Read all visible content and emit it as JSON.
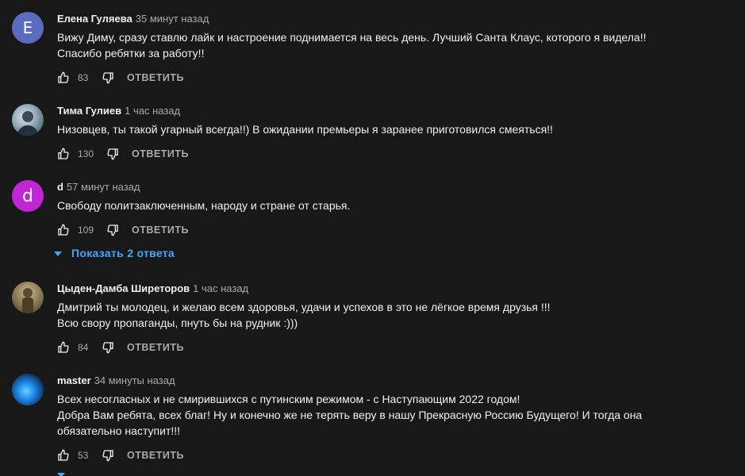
{
  "comments": [
    {
      "author": "Елена Гуляева",
      "time": "35 минут назад",
      "avatar_letter": "E",
      "avatar_color": "#5c6bc0",
      "lines": [
        "Вижу Диму, сразу ставлю лайк и настроение поднимается на весь день. Лучший Санта Клаус, которого я видела!!",
        "Спасибо ребятки за работу!!"
      ],
      "likes": "83",
      "reply_label": "ОТВЕТИТЬ"
    },
    {
      "author": "Тима Гулиев",
      "time": "1 час назад",
      "avatar_letter": "",
      "avatar_color": "#8fa9b8",
      "lines": [
        "Низовцев, ты такой угарный всегда!!) В ожидании премьеры я заранее приготовился смеяться!!"
      ],
      "likes": "130",
      "reply_label": "ОТВЕТИТЬ"
    },
    {
      "author": "d",
      "time": "57 минут назад",
      "avatar_letter": "d",
      "avatar_color": "#c026d3",
      "lines": [
        "Свободу политзаключенным, народу и стране от старья."
      ],
      "likes": "109",
      "reply_label": "ОТВЕТИТЬ",
      "replies_toggle": "Показать 2 ответа"
    },
    {
      "author": "Цыден-Дамба Ширеторов",
      "time": "1 час назад",
      "avatar_letter": "",
      "avatar_color": "#8a7a52",
      "lines": [
        "Дмитрий ты молодец, и желаю всем здоровья, удачи и успехов в это не лёгкое время друзья !!!",
        "Всю свору пропаганды, пнуть бы на рудник :)))"
      ],
      "likes": "84",
      "reply_label": "ОТВЕТИТЬ"
    },
    {
      "author": "master",
      "time": "34 минуты назад",
      "avatar_letter": "",
      "avatar_color": "#1565c0",
      "lines": [
        "Всех несогласных и не смирившихся с путинским режимом - с  Наступающим 2022 годом!",
        "Добра Вам ребята, всех благ! Ну  и конечно же не терять веру в нашу Прекрасную Россию Будущего! И тогда она",
        "обязательно наступит!!!"
      ],
      "likes": "53",
      "reply_label": "ОТВЕТИТЬ"
    }
  ]
}
